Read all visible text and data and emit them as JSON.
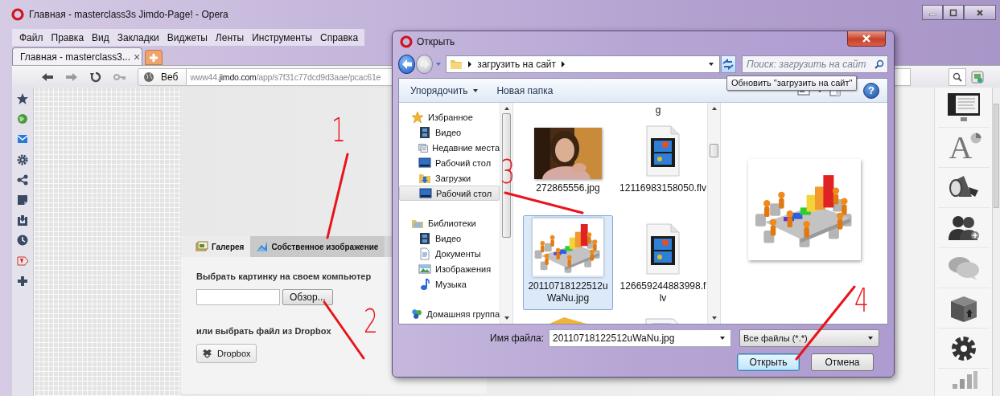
{
  "browser": {
    "title": "Главная - masterclass3s Jimdo-Page! - Opera",
    "menu": [
      "Файл",
      "Правка",
      "Вид",
      "Закладки",
      "Виджеты",
      "Ленты",
      "Инструменты",
      "Справка"
    ],
    "tabs": [
      {
        "label": "Главная - masterclass3...",
        "selected": true,
        "close": "×"
      }
    ],
    "address": {
      "mode": "Веб",
      "url": "www44.**jimdo.com**/app/s7f31c77dcd9d3aae/pcac61e"
    }
  },
  "page": {
    "image_panel": {
      "tabs": [
        {
          "label": "Галерея",
          "kind": "gallery",
          "selected": false
        },
        {
          "label": "Собственное изображение",
          "kind": "upload",
          "selected": true
        }
      ],
      "prompt": "Выбрать картинку на своем компьютер",
      "browse_button": "Обзор...",
      "dropbox_prompt": "или выбрать файл из Dropbox",
      "dropbox_button": "Dropbox"
    },
    "tools": [
      {
        "kind": "layout"
      },
      {
        "kind": "style",
        "glyph": "A"
      },
      {
        "kind": "megaphone"
      },
      {
        "kind": "users"
      },
      {
        "kind": "chat"
      },
      {
        "kind": "box"
      },
      {
        "kind": "gear"
      },
      {
        "kind": "stats"
      }
    ]
  },
  "dialog": {
    "title": "Открыть",
    "breadcrumb": "загрузить на сайт",
    "search": {
      "placeholder": "Поиск: загрузить на сайт"
    },
    "tooltip": "Обновить \"загрузить на сайт\"",
    "organize": "Упорядочить",
    "new_folder": "Новая папка",
    "help_glyph": "?",
    "nav": [
      {
        "label": "Избранное",
        "kind": "favorites",
        "selected": false,
        "children": [
          {
            "label": "Видео",
            "kind": "video",
            "selected": false
          },
          {
            "label": "Недавние места",
            "kind": "recent",
            "selected": false
          },
          {
            "label": "Рабочий стол",
            "kind": "desktop",
            "selected": false
          },
          {
            "label": "Загрузки",
            "kind": "downloads",
            "selected": false
          },
          {
            "label": "Рабочий стол",
            "kind": "desktop",
            "selected": true
          }
        ]
      },
      {
        "label": "Библиотеки",
        "kind": "libraries",
        "selected": false,
        "children": [
          {
            "label": "Видео",
            "kind": "video",
            "selected": false
          },
          {
            "label": "Документы",
            "kind": "documents",
            "selected": false
          },
          {
            "label": "Изображения",
            "kind": "images",
            "selected": false
          },
          {
            "label": "Музыка",
            "kind": "music",
            "selected": false
          }
        ]
      },
      {
        "label": "Домашняя группа",
        "kind": "homegroup",
        "selected": false
      }
    ],
    "cut_label": "g",
    "files": [
      {
        "name": "272865556.jpg",
        "selected": false
      },
      {
        "name": "12116983158050.flv",
        "kind": "video",
        "selected": false
      },
      {
        "name": "20110718122512uWaNu.jpg",
        "kind": "clipart",
        "selected": true
      },
      {
        "name": "126659244883998.flv",
        "kind": "video",
        "selected": false
      },
      {
        "kind": "folder",
        "selected": false
      },
      {
        "kind": "document",
        "selected": false
      }
    ],
    "file_name_label": "Имя файла:",
    "file_name": "20110718122512uWaNu.jpg",
    "file_type": "Все файлы (*.*)",
    "open_button": "Открыть",
    "cancel_button": "Отмена"
  },
  "annotations": [
    {
      "label": "1"
    },
    {
      "label": "2"
    },
    {
      "label": "3"
    },
    {
      "label": "4"
    }
  ]
}
